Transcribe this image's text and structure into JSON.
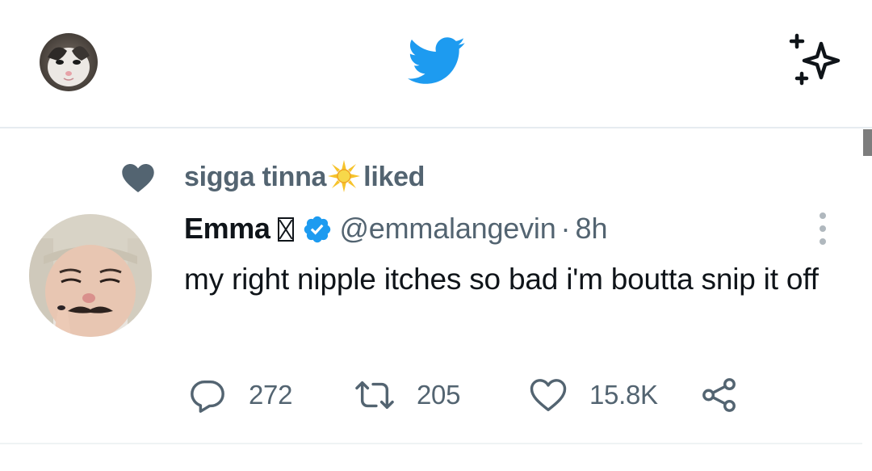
{
  "header": {
    "logo_icon": "twitter-bird-icon",
    "sparkle_icon": "sparkle-icon",
    "brand_color": "#1d9bf0"
  },
  "tweet": {
    "social_context": {
      "icon": "heart-filled-icon",
      "liker_name": "sigga tinna",
      "liker_emoji": "sun-emoji",
      "action_text": "liked"
    },
    "author": {
      "display_name": "Emma",
      "verified_icon": "verified-badge-icon",
      "handle": "@emmalangevin",
      "separator": "·",
      "time": "8h"
    },
    "text": "my right nipple itches so bad i'm boutta snip it off",
    "actions": {
      "reply_count": "272",
      "retweet_count": "205",
      "like_count": "15.8K"
    }
  },
  "colors": {
    "muted_text": "#536471",
    "verified_blue": "#1d9bf0"
  }
}
